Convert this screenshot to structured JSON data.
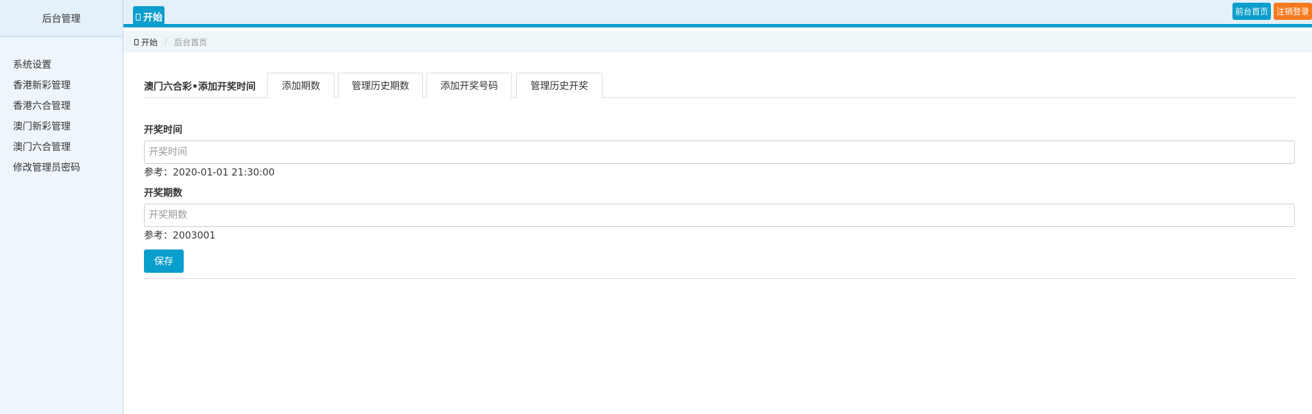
{
  "sidebar": {
    "title": "后台管理",
    "items": [
      {
        "label": "系统设置"
      },
      {
        "label": "香港新彩管理"
      },
      {
        "label": "香港六合管理"
      },
      {
        "label": "澳门新彩管理"
      },
      {
        "label": "澳门六合管理"
      },
      {
        "label": "修改管理员密码"
      }
    ]
  },
  "topbar": {
    "tab_label": "开始",
    "home_button": "前台首页",
    "logout_button": "注销登录",
    "colors": {
      "accent": "#0a9ecc",
      "logout": "#f77a1f"
    }
  },
  "breadcrumb": {
    "first": "开始",
    "current": "后台首页"
  },
  "main": {
    "heading": "澳门六合彩•添加开奖时间",
    "tabs": [
      {
        "label": "添加期数"
      },
      {
        "label": "管理历史期数"
      },
      {
        "label": "添加开奖号码"
      },
      {
        "label": "管理历史开奖"
      }
    ],
    "form": {
      "time_label": "开奖时间",
      "time_placeholder": "开奖时间",
      "time_value": "",
      "time_hint": "参考：2020-01-01 21:30:00",
      "period_label": "开奖期数",
      "period_placeholder": "开奖期数",
      "period_value": "",
      "period_hint": "参考：2003001",
      "save_label": "保存"
    }
  }
}
